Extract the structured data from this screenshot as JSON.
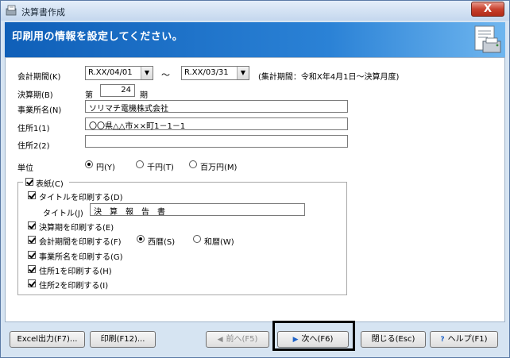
{
  "window": {
    "title": "決算書作成",
    "close_label": "X"
  },
  "header": {
    "text": "印刷用の情報を設定してください。"
  },
  "period": {
    "label": "会計期間(K)",
    "from_value": "R.XX/04/01",
    "separator": "～",
    "to_value": "R.XX/03/31",
    "note": "(集計期間：令和X年4月1日～決算月度)"
  },
  "fiscal_term": {
    "label": "決算期(B)",
    "prefix": "第",
    "value": "24",
    "suffix": "期"
  },
  "office_name": {
    "label": "事業所名(N)",
    "value": "ソリマチ電機株式会社"
  },
  "address1": {
    "label": "住所1(1)",
    "value": "〇〇県△△市××町1－1－1"
  },
  "address2": {
    "label": "住所2(2)",
    "value": ""
  },
  "unit": {
    "label": "単位",
    "options": [
      "円(Y)",
      "千円(T)",
      "百万円(M)"
    ],
    "selected": "円(Y)"
  },
  "cover": {
    "label": "表紙(C)",
    "checked": true,
    "print_title": {
      "label": "タイトルを印刷する(D)",
      "checked": true
    },
    "title_label": "タイトル(J)",
    "title_value": "決　算　報　告　書",
    "print_fiscal": {
      "label": "決算期を印刷する(E)",
      "checked": true
    },
    "print_period": {
      "label": "会計期間を印刷する(F)",
      "checked": true
    },
    "calendar_options": [
      "西暦(S)",
      "和暦(W)"
    ],
    "calendar_selected": "西暦(S)",
    "print_office": {
      "label": "事業所名を印刷する(G)",
      "checked": true
    },
    "print_addr1": {
      "label": "住所1を印刷する(H)",
      "checked": true
    },
    "print_addr2": {
      "label": "住所2を印刷する(I)",
      "checked": true
    }
  },
  "buttons": {
    "excel": "Excel出力(F7)...",
    "print": "印刷(F12)...",
    "prev": "前へ(F5)",
    "next": "次へ(F6)",
    "close": "閉じる(Esc)",
    "help": "ヘルプ(F1)"
  }
}
